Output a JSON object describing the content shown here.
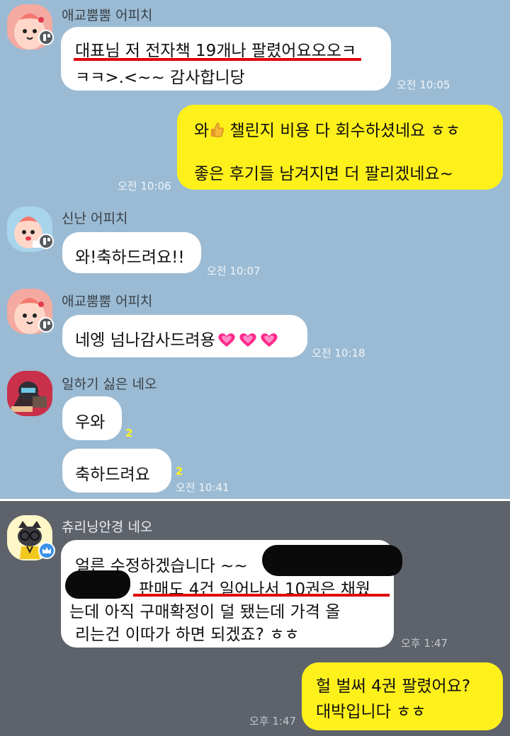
{
  "messages": [
    {
      "sender": "애교뿜뿜 어피치",
      "lines": [
        "대표님 저 전자책 19개나 팔렸어요오오ㅋ",
        "ㅋㅋ>.<~~ 감사합니당"
      ],
      "time": "오전 10:05"
    },
    {
      "sender": "me",
      "lines": [
        "와",
        " 챌린지 비용 다 회수하셨네요 ㅎㅎ",
        "좋은 후기들 남겨지면 더 팔리겠네요~"
      ],
      "time": "오전 10:06"
    },
    {
      "sender": "신난 어피치",
      "text": "와!축하드려요!!",
      "time": "오전 10:07"
    },
    {
      "sender": "애교뿜뿜 어피치",
      "text": "네엥 넘나감사드려용",
      "time": "오전 10:18"
    },
    {
      "sender": "일하기 싫은 네오",
      "texts": [
        "우와",
        "축하드려요"
      ],
      "unread": [
        "2",
        "2"
      ],
      "time": "오전 10:41"
    },
    {
      "sender": "츄리닝안경 네오",
      "lines": [
        "얼른 수정하겠습니다 ~~",
        "판매도 4건 일어나서 10권은 채웠",
        "는데 아직 구매확정이 덜 됐는데 가격 올",
        "리는건 이따가 하면 되겠죠? ㅎㅎ"
      ],
      "time": "오후 1:47"
    },
    {
      "sender": "me",
      "lines": [
        "헐 벌써 4권 팔렸어요?",
        "대박입니다 ㅎㅎ"
      ],
      "time": "오후 1:47"
    }
  ],
  "colors": {
    "chat_bg_top": "#9bbbd4",
    "chat_bg_bottom": "#5d626b",
    "my_bubble": "#fef01b",
    "other_bubble": "#ffffff",
    "highlight_underline": "#e0000c",
    "redaction": "#0a0a0a"
  }
}
